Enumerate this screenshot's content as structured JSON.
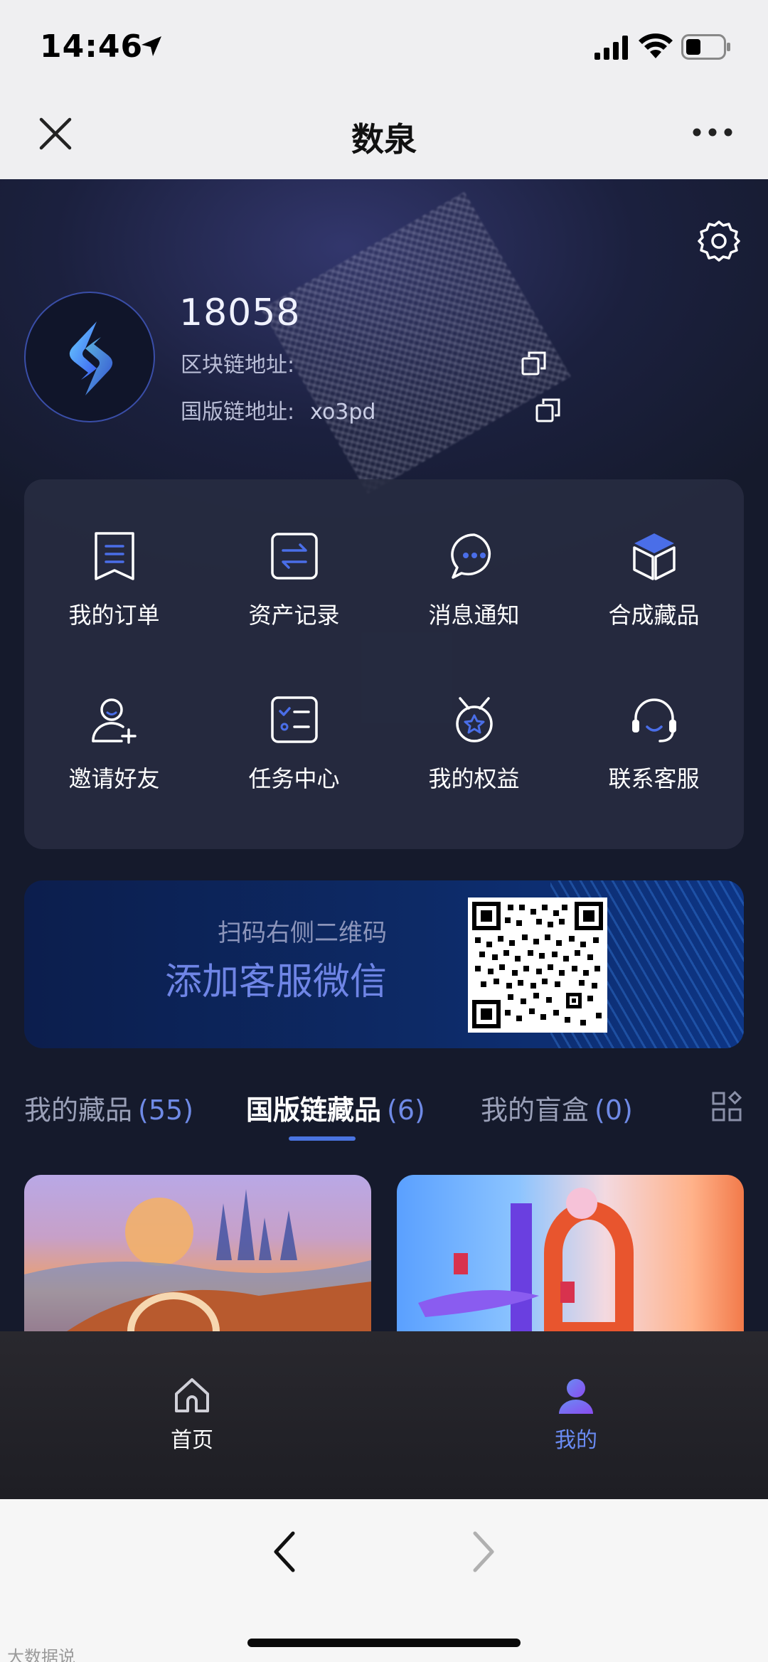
{
  "status": {
    "time": "14:46"
  },
  "nav": {
    "title": "数泉"
  },
  "profile": {
    "phone": "18058",
    "block_label": "区块链地址:",
    "block_value": "",
    "national_label": "国版链地址:",
    "national_value": "xo3pd"
  },
  "menu": [
    {
      "label": "我的订单",
      "icon": "order-icon"
    },
    {
      "label": "资产记录",
      "icon": "transfer-icon"
    },
    {
      "label": "消息通知",
      "icon": "message-icon"
    },
    {
      "label": "合成藏品",
      "icon": "cube-icon"
    },
    {
      "label": "邀请好友",
      "icon": "invite-user-icon"
    },
    {
      "label": "任务中心",
      "icon": "task-list-icon"
    },
    {
      "label": "我的权益",
      "icon": "medal-icon"
    },
    {
      "label": "联系客服",
      "icon": "headset-icon"
    }
  ],
  "banner": {
    "subtitle": "扫码右侧二维码",
    "title": "添加客服微信"
  },
  "tabs": [
    {
      "label": "我的藏品",
      "count": "(55)"
    },
    {
      "label": "国版链藏品",
      "count": "(6)"
    },
    {
      "label": "我的盲盒",
      "count": "(0)"
    }
  ],
  "tabbar": {
    "home": "首页",
    "mine": "我的"
  },
  "watermark": "大数据说",
  "colors": {
    "accent": "#6a8bf3",
    "background": "#151a2c",
    "card": "#282d42"
  }
}
